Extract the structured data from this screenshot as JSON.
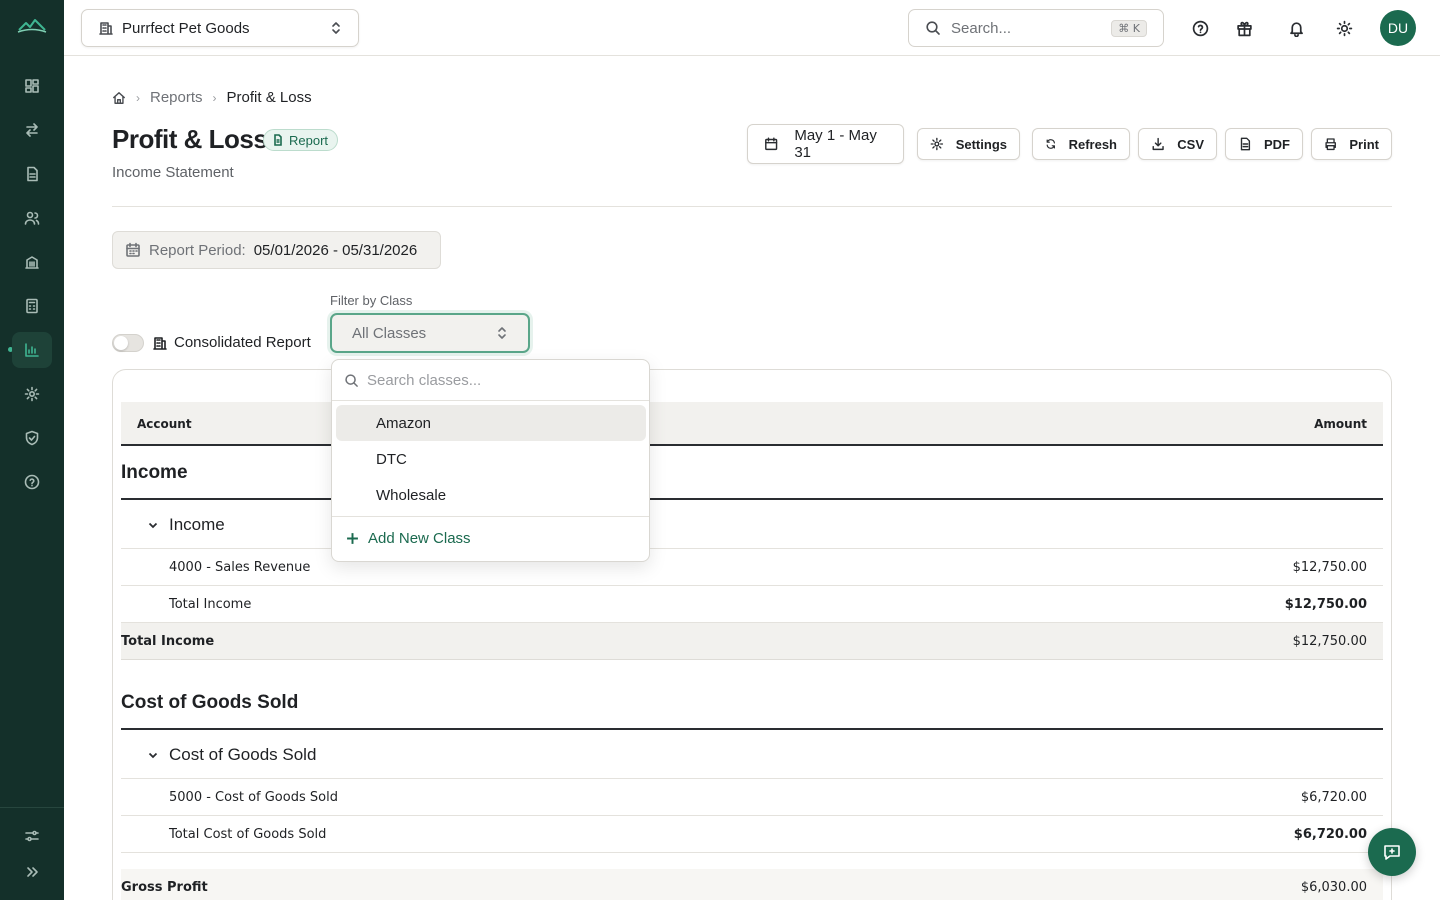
{
  "company": {
    "name": "Purrfect Pet Goods"
  },
  "search": {
    "placeholder": "Search...",
    "shortcut": "⌘ K"
  },
  "user": {
    "initials": "DU"
  },
  "breadcrumb": {
    "reports": "Reports",
    "current": "Profit & Loss"
  },
  "header": {
    "title": "Profit & Loss",
    "badge": "Report",
    "subtitle": "Income Statement"
  },
  "toolbar": {
    "date_range": "May 1 - May 31",
    "settings": "Settings",
    "refresh": "Refresh",
    "csv": "CSV",
    "pdf": "PDF",
    "print": "Print"
  },
  "period": {
    "label": "Report Period:",
    "value": "05/01/2026 - 05/31/2026"
  },
  "consolidated": {
    "label": "Consolidated Report",
    "enabled": false
  },
  "filter": {
    "label": "Filter by Class",
    "selected": "All Classes",
    "search_placeholder": "Search classes...",
    "options": [
      "Amazon",
      "DTC",
      "Wholesale"
    ],
    "add_label": "Add New Class"
  },
  "table": {
    "col_account": "Account",
    "col_amount": "Amount",
    "income": {
      "section_title": "Income",
      "group_title": "Income",
      "rows": [
        {
          "account": "4000 - Sales Revenue",
          "amount": "$12,750.00"
        }
      ],
      "group_total_label": "Total Income",
      "group_total": "$12,750.00",
      "section_total_label": "Total Income",
      "section_total": "$12,750.00"
    },
    "cogs": {
      "section_title": "Cost of Goods Sold",
      "group_title": "Cost of Goods Sold",
      "rows": [
        {
          "account": "5000 - Cost of Goods Sold",
          "amount": "$6,720.00"
        }
      ],
      "group_total_label": "Total Cost of Goods Sold",
      "group_total": "$6,720.00"
    },
    "gross_profit_label": "Gross Profit",
    "gross_profit": "$6,030.00"
  },
  "colors": {
    "sidebar": "#14302a",
    "accent": "#1b6a4f",
    "accent_light": "#3fb592"
  }
}
